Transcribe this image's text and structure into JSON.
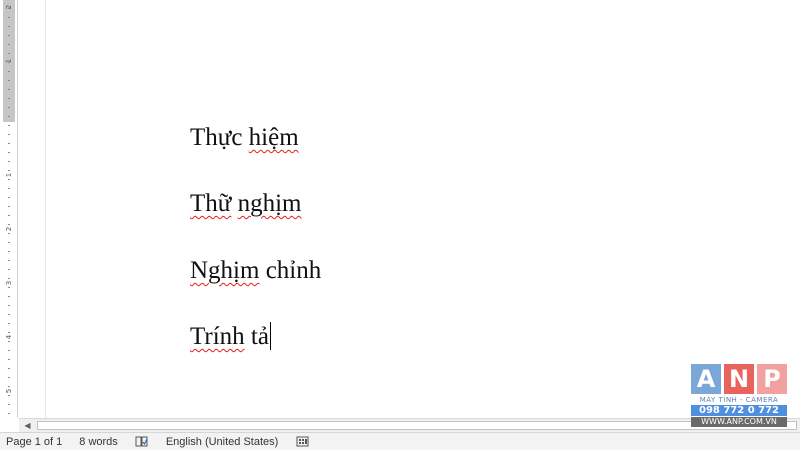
{
  "document": {
    "lines": [
      {
        "parts": [
          {
            "text": "Thực ",
            "error": false
          },
          {
            "text": "hiệm",
            "error": true
          }
        ]
      },
      {
        "parts": [
          {
            "text": "Thữ",
            "error": true
          },
          {
            "text": " ",
            "error": false
          },
          {
            "text": "nghịm",
            "error": true
          }
        ]
      },
      {
        "parts": [
          {
            "text": "Nghịm",
            "error": true
          },
          {
            "text": " chỉnh",
            "error": false
          }
        ]
      },
      {
        "parts": [
          {
            "text": "Trính",
            "error": true
          },
          {
            "text": " tả",
            "error": false
          }
        ]
      }
    ]
  },
  "ruler": {
    "labels": [
      "2",
      "1",
      "1",
      "2",
      "3",
      "4",
      "5"
    ]
  },
  "statusbar": {
    "page": "Page 1 of 1",
    "words": "8 words",
    "proofing_icon": "proofing-book-icon",
    "language": "English (United States)",
    "macro_icon": "macro-record-icon"
  },
  "watermark": {
    "letters": [
      "A",
      "N",
      "P"
    ],
    "letter_colors": [
      "#7aa6d8",
      "#e8635d",
      "#f3a0a0"
    ],
    "subtitle": "MÁY TÍNH - CAMERA",
    "phone": "098 772 0 772",
    "website": "WWW.ANP.COM.VN"
  },
  "colors": {
    "spell_error": "#e0201b",
    "ruler_margin": "#c6c6c6"
  }
}
